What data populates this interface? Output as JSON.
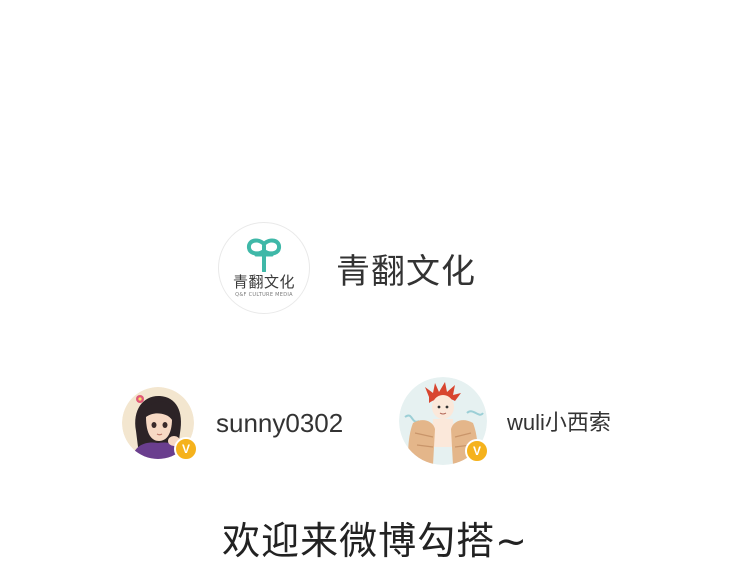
{
  "brand": {
    "logo_cn": "青翻文化",
    "logo_en": "Q&F CULTURE MEDIA",
    "name": "青翻文化",
    "logo_color": "#3fb8a8"
  },
  "users": [
    {
      "name": "sunny0302",
      "badge": "V",
      "avatar_icon": "anime-girl-avatar"
    },
    {
      "name": "wuli小西索",
      "badge": "V",
      "avatar_icon": "anime-boy-towel-avatar"
    }
  ],
  "badge_color": "#f5b21c",
  "welcome_text": "欢迎来微博勾搭~"
}
